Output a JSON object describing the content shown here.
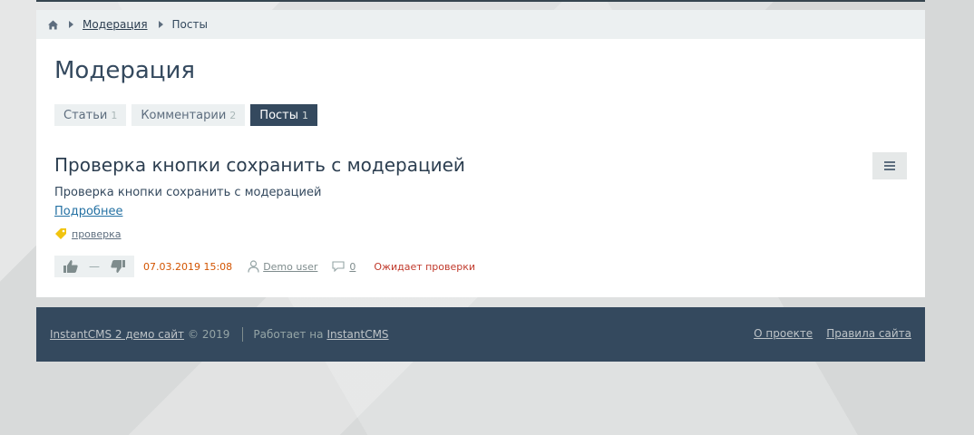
{
  "breadcrumbs": {
    "link_label": "Модерация",
    "current_label": "Посты"
  },
  "page": {
    "title": "Модерация"
  },
  "tabs": [
    {
      "label": "Статьи",
      "count": "1"
    },
    {
      "label": "Комментарии",
      "count": "2"
    },
    {
      "label": "Посты",
      "count": "1"
    }
  ],
  "post": {
    "title": "Проверка кнопки сохранить с модерацией",
    "text": "Проверка кнопки сохранить с модерацией",
    "more_label": "Подробнее",
    "tag": "проверка",
    "rating": "—",
    "date": "07.03.2019 15:08",
    "author": "Demo user",
    "comments": "0",
    "status": "Ожидает проверки"
  },
  "footer": {
    "site_link": "InstantCMS 2 демо сайт",
    "copyright": "© 2019",
    "powered_prefix": "Работает на",
    "powered_link": "InstantCMS",
    "about_label": "О проекте",
    "rules_label": "Правила сайта"
  },
  "colors": {
    "accent": "#34495e",
    "date": "#d35400",
    "status": "#c0392b",
    "tag": "#f1c40f"
  }
}
